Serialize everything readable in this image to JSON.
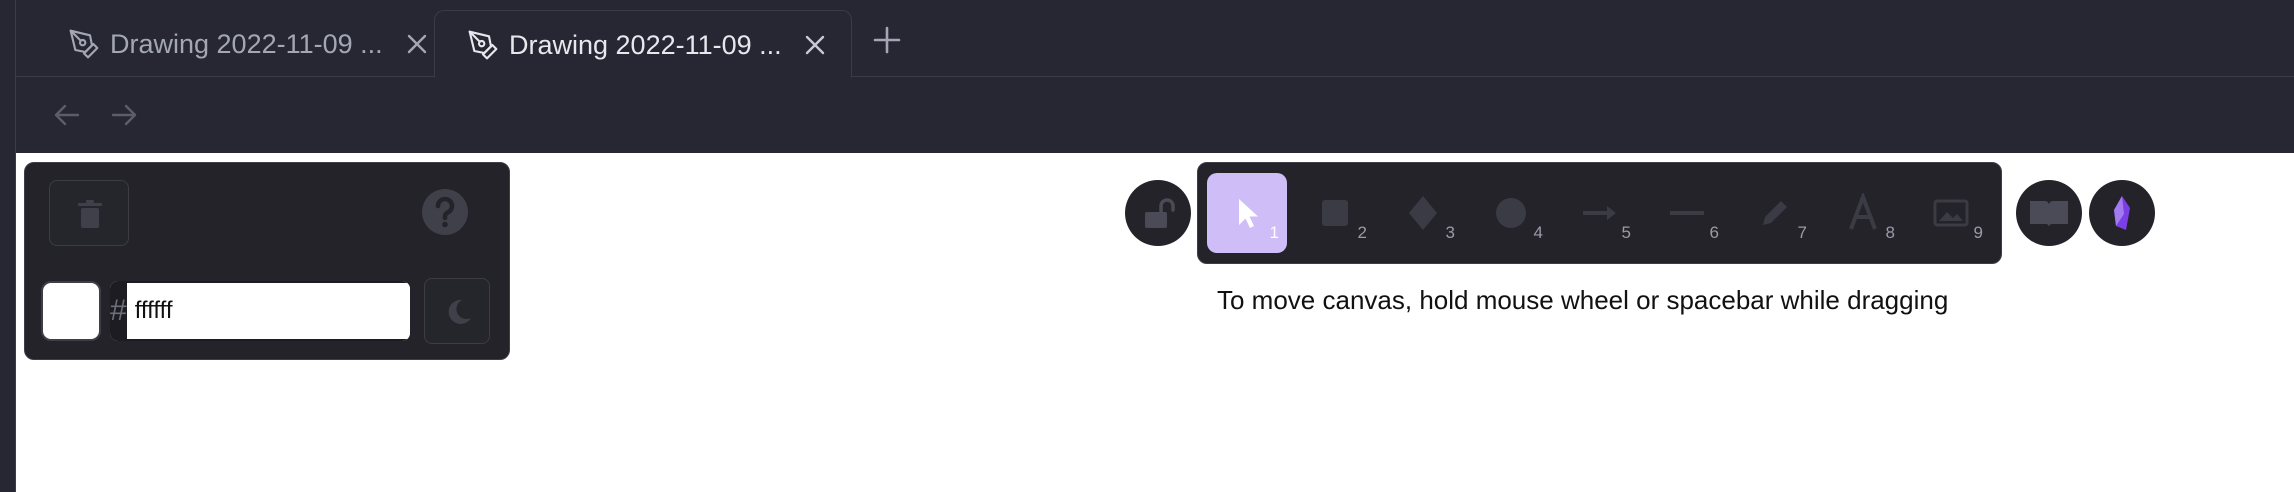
{
  "tabs": [
    {
      "title": "Drawing 2022-11-09 ...",
      "active": false,
      "icon": "pen-tool-icon"
    },
    {
      "title": "Drawing 2022-11-09 ...",
      "active": true,
      "icon": "pen-tool-icon"
    }
  ],
  "nav": {
    "back_icon": "arrow-left-icon",
    "forward_icon": "arrow-right-icon"
  },
  "color_panel": {
    "hex_prefix": "#",
    "hex_value": "ffffff",
    "swatch_color": "#ffffff"
  },
  "tools": [
    {
      "name": "selection",
      "icon": "cursor-icon",
      "key": "1",
      "active": true
    },
    {
      "name": "rectangle",
      "icon": "square-icon",
      "key": "2",
      "active": false
    },
    {
      "name": "diamond",
      "icon": "diamond-icon",
      "key": "3",
      "active": false
    },
    {
      "name": "ellipse",
      "icon": "circle-icon",
      "key": "4",
      "active": false
    },
    {
      "name": "arrow",
      "icon": "arrow-icon",
      "key": "5",
      "active": false
    },
    {
      "name": "line",
      "icon": "line-icon",
      "key": "6",
      "active": false
    },
    {
      "name": "draw",
      "icon": "pencil-icon",
      "key": "7",
      "active": false
    },
    {
      "name": "text",
      "icon": "text-icon",
      "key": "8",
      "active": false
    },
    {
      "name": "image",
      "icon": "image-icon",
      "key": "9",
      "active": false
    }
  ],
  "hint_text": "To move canvas, hold mouse wheel or spacebar while dragging",
  "colors": {
    "chrome_bg": "#262733",
    "panel_bg": "#232329",
    "active_tool": "#cfbdf7",
    "gem": "#7b3fe4"
  }
}
